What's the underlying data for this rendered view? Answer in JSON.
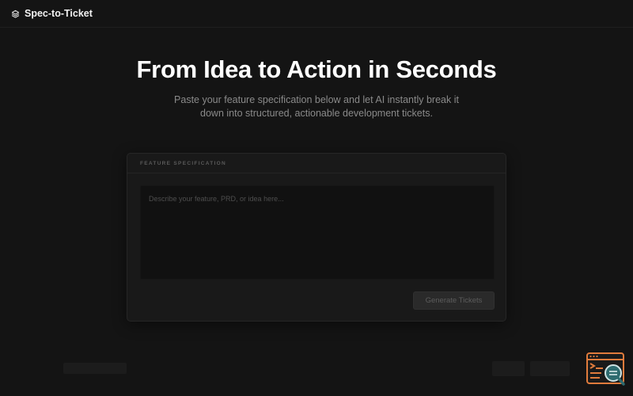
{
  "header": {
    "brand_name": "Spec-to-Ticket",
    "brand_icon": "layers-icon"
  },
  "hero": {
    "title": "From Idea to Action in Seconds",
    "subtitle": "Paste your feature specification below and let AI instantly break it down into structured, actionable development tickets."
  },
  "spec_card": {
    "label": "FEATURE SPECIFICATION",
    "input_value": "",
    "input_placeholder": "Describe your feature, PRD, or idea here...",
    "generate_label": "Generate Tickets"
  },
  "assistant_widget": {
    "icon": "terminal-search-icon"
  },
  "colors": {
    "background": "#141414",
    "card": "#191919",
    "input": "#111111",
    "widget_accent": "#e07b3c",
    "widget_teal": "#2e6b6f"
  }
}
